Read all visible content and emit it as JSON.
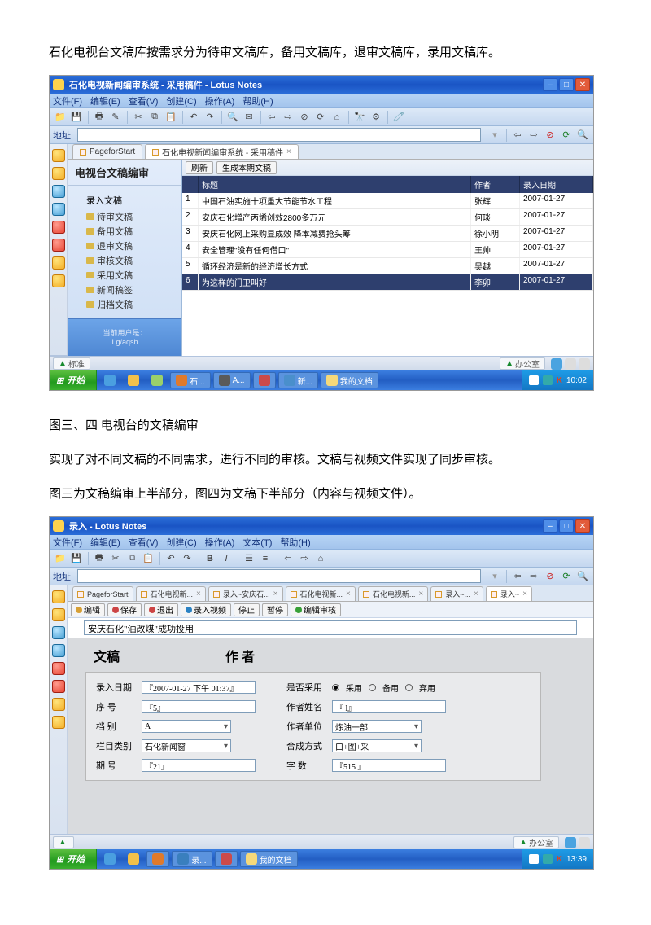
{
  "doc": {
    "para1": "石化电视台文稿库按需求分为待审文稿库，备用文稿库，退审文稿库，录用文稿库。",
    "caption": "图三、四 电视台的文稿编审",
    "para2": "实现了对不同文稿的不同需求，进行不同的审核。文稿与视频文件实现了同步审核。",
    "para3": "图三为文稿编审上半部分，图四为文稿下半部分（内容与视频文件）。"
  },
  "sc1": {
    "title": "石化电视新闻编审系统 - 采用稿件 - Lotus Notes",
    "menus": [
      "文件(F)",
      "编辑(E)",
      "查看(V)",
      "创建(C)",
      "操作(A)",
      "帮助(H)"
    ],
    "addr_label": "地址",
    "tabs": [
      "PageforStart",
      "石化电视新闻编审系统 - 采用稿件"
    ],
    "nav_title": "电视台文稿编审",
    "nav_root": "录入文稿",
    "nav_items": [
      "待审文稿",
      "备用文稿",
      "退审文稿",
      "审核文稿",
      "采用文稿",
      "新闻稿签",
      "归档文稿"
    ],
    "nav_user_lbl": "当前用户是：",
    "nav_user": "Lg/aqsh",
    "list_btns": [
      "刷新",
      "生成本期文稿"
    ],
    "grid_head": [
      "",
      "标题",
      "作者",
      "录入日期"
    ],
    "rows": [
      {
        "i": "1",
        "t": "中国石油实施十项重大节能节水工程",
        "a": "张辉",
        "d": "2007-01-27"
      },
      {
        "i": "2",
        "t": "安庆石化增产丙烯创效2800多万元",
        "a": "何琰",
        "d": "2007-01-27"
      },
      {
        "i": "3",
        "t": "安庆石化网上采购显成效 降本减费抢头筹",
        "a": "徐小明",
        "d": "2007-01-27"
      },
      {
        "i": "4",
        "t": "安全管理\"没有任何借口\"",
        "a": "王帅",
        "d": "2007-01-27"
      },
      {
        "i": "5",
        "t": "循环经济是新的经济增长方式",
        "a": "吴越",
        "d": "2007-01-27"
      },
      {
        "i": "6",
        "t": "为这样的门卫叫好",
        "a": "李卯",
        "d": "2007-01-27"
      }
    ],
    "status_left": "标准",
    "status_right": "办公室",
    "start": "开始",
    "time": "10:02"
  },
  "sc2": {
    "title": "录入 - Lotus Notes",
    "menus": [
      "文件(F)",
      "编辑(E)",
      "查看(V)",
      "创建(C)",
      "操作(A)",
      "文本(T)",
      "帮助(H)"
    ],
    "addr_label": "地址",
    "tabs": [
      "PageforStart",
      "石化电视新...",
      "录入~安庆石...",
      "石化电视新...",
      "石化电视新...",
      "录入~...",
      "录入~"
    ],
    "actions": [
      "编辑",
      "保存",
      "退出",
      "录入视频",
      "停止",
      "暂停",
      "编辑审核"
    ],
    "headline": "安庆石化\"油改煤\"成功投用",
    "section_left": "文稿",
    "section_right": "作 者",
    "fields_left": [
      {
        "l": "录入日期",
        "v": "『2007-01-27 下午 01:37』",
        "type": "text"
      },
      {
        "l": "序  号",
        "v": "『5』",
        "type": "text"
      },
      {
        "l": "档  别",
        "v": "A",
        "type": "select"
      },
      {
        "l": "栏目类别",
        "v": "石化新闻窗",
        "type": "select"
      },
      {
        "l": "期  号",
        "v": "『21』",
        "type": "text"
      }
    ],
    "fields_right": [
      {
        "l": "是否采用",
        "type": "radio",
        "opts": [
          "采用",
          "备用",
          "弃用"
        ],
        "checked": 0
      },
      {
        "l": "作者姓名",
        "v": "『 l』",
        "type": "text"
      },
      {
        "l": "作者单位",
        "v": "炼油一部",
        "type": "select"
      },
      {
        "l": "合成方式",
        "v": "口+图+采",
        "type": "select"
      },
      {
        "l": "字  数",
        "v": "『515 』",
        "type": "text"
      }
    ],
    "status_right": "办公室",
    "start": "开始",
    "time": "13:39"
  }
}
